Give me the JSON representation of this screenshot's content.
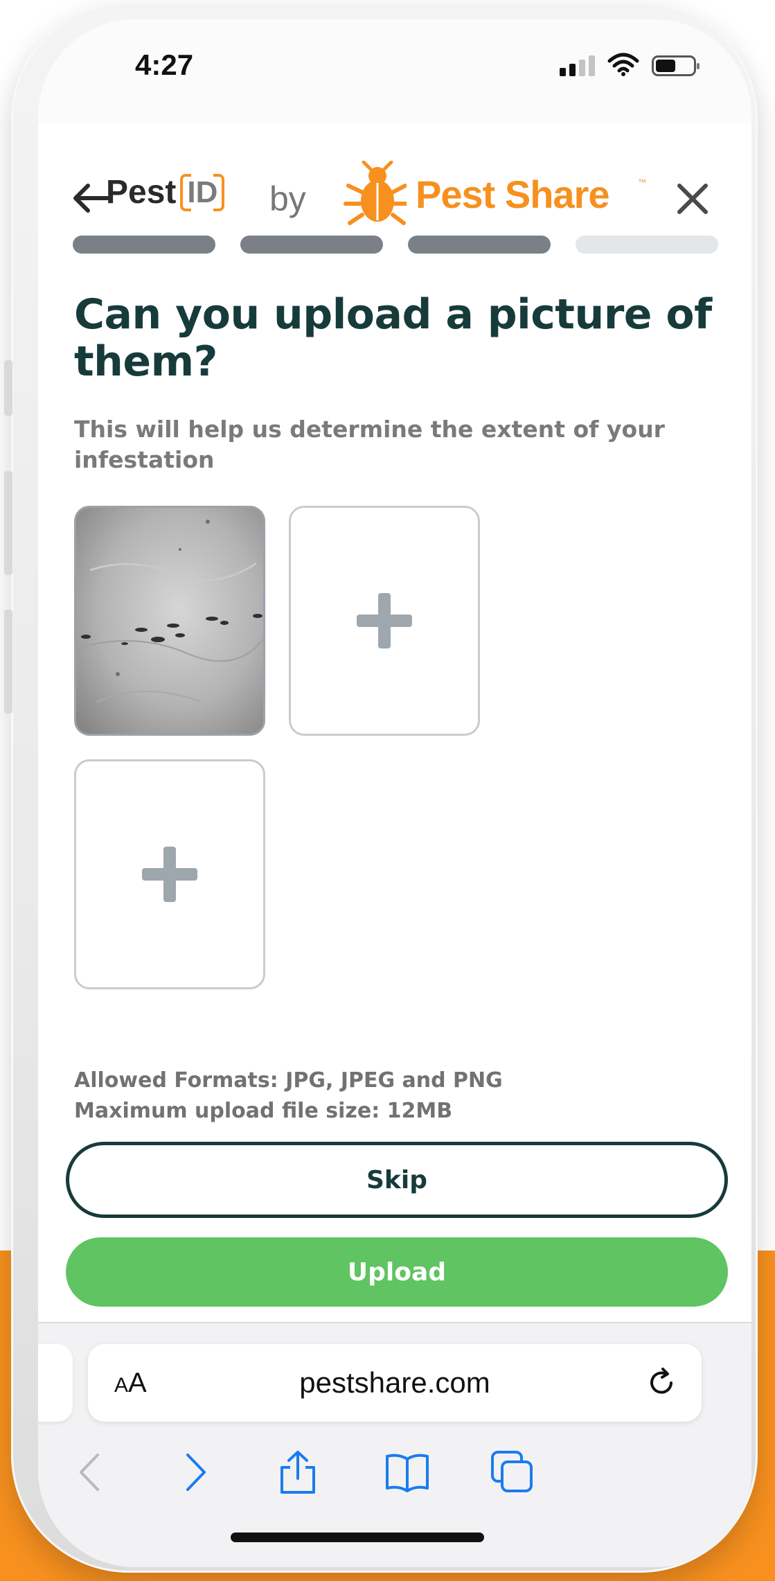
{
  "status_bar": {
    "time": "4:27"
  },
  "header": {
    "brand_pest": "Pest",
    "brand_id": "ID",
    "by": "by",
    "partner_name": "Pest Share",
    "partner_tm": "™"
  },
  "progress": {
    "total_steps": 4,
    "completed_steps": 3
  },
  "content": {
    "title": "Can you upload a picture of them?",
    "subtitle": "This will help us determine the extent of your infestation",
    "allowed_formats": "Allowed Formats: JPG, JPEG and PNG",
    "max_size": "Maximum upload file size: 12MB"
  },
  "buttons": {
    "skip": "Skip",
    "upload": "Upload"
  },
  "browser": {
    "aa_big": "A",
    "aa_small": "A",
    "url": "pestshare.com"
  },
  "colors": {
    "brand_orange": "#f7901e",
    "title_teal": "#173b3b",
    "upload_green": "#5fc461",
    "progress_done": "#7b8087",
    "progress_todo": "#e4e7ea",
    "ios_blue": "#1a7cf0"
  },
  "icons": {
    "back": "arrow-left-icon",
    "close": "close-icon",
    "add": "plus-icon",
    "reload": "reload-icon",
    "share": "share-icon",
    "bookmarks": "book-icon",
    "tabs": "tabs-icon"
  }
}
